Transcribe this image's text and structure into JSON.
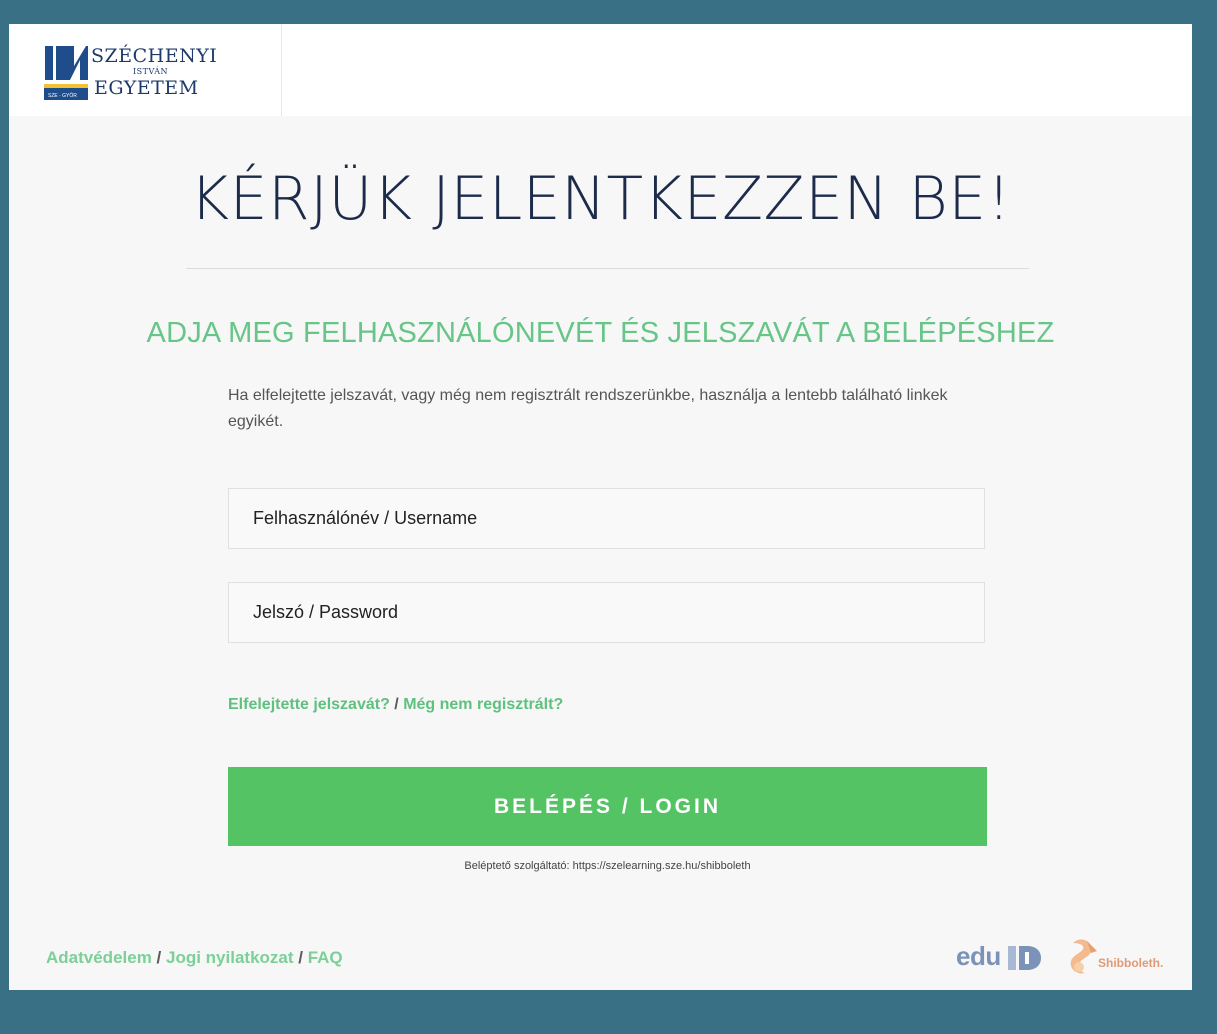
{
  "logo": {
    "line1": "SZÉCHENYI",
    "line2": "ISTVÁN",
    "line3": "EGYETEM",
    "emblem_caption": "SZE · GYŐR"
  },
  "title": "KÉRJÜK JELENTKEZZEN BE!",
  "subtitle": "ADJA MEG FELHASZNÁLÓNEVÉT ÉS JELSZAVÁT A BELÉPÉSHEZ",
  "info_text": "Ha elfelejtette jelszavát, vagy még nem regisztrált rendszerünkbe, használja a lentebb található linkek egyikét.",
  "form": {
    "username_placeholder": "Felhasználónév / Username",
    "password_placeholder": "Jelszó / Password",
    "forgot_link": "Elfelejtette jelszavát?",
    "separator": " / ",
    "register_link": "Még nem regisztrált?",
    "login_button": "BELÉPÉS / LOGIN"
  },
  "provider_text": "Beléptető szolgáltató: https://szelearning.sze.hu/shibboleth",
  "footer": {
    "privacy": "Adatvédelem",
    "legal": "Jogi nyilatkozat",
    "faq": "FAQ",
    "separator": " / ",
    "eduid_text": "edu",
    "shibboleth_text": "Shibboleth."
  },
  "colors": {
    "background": "#3a7086",
    "panel": "#f7f7f7",
    "accent_green": "#53c364",
    "link_green": "#5fc17e",
    "title_navy": "#1d2b4a"
  },
  "icons": {
    "logo": "university-emblem-icon",
    "eduid": "eduid-logo-icon",
    "shibboleth": "shibboleth-logo-icon"
  }
}
